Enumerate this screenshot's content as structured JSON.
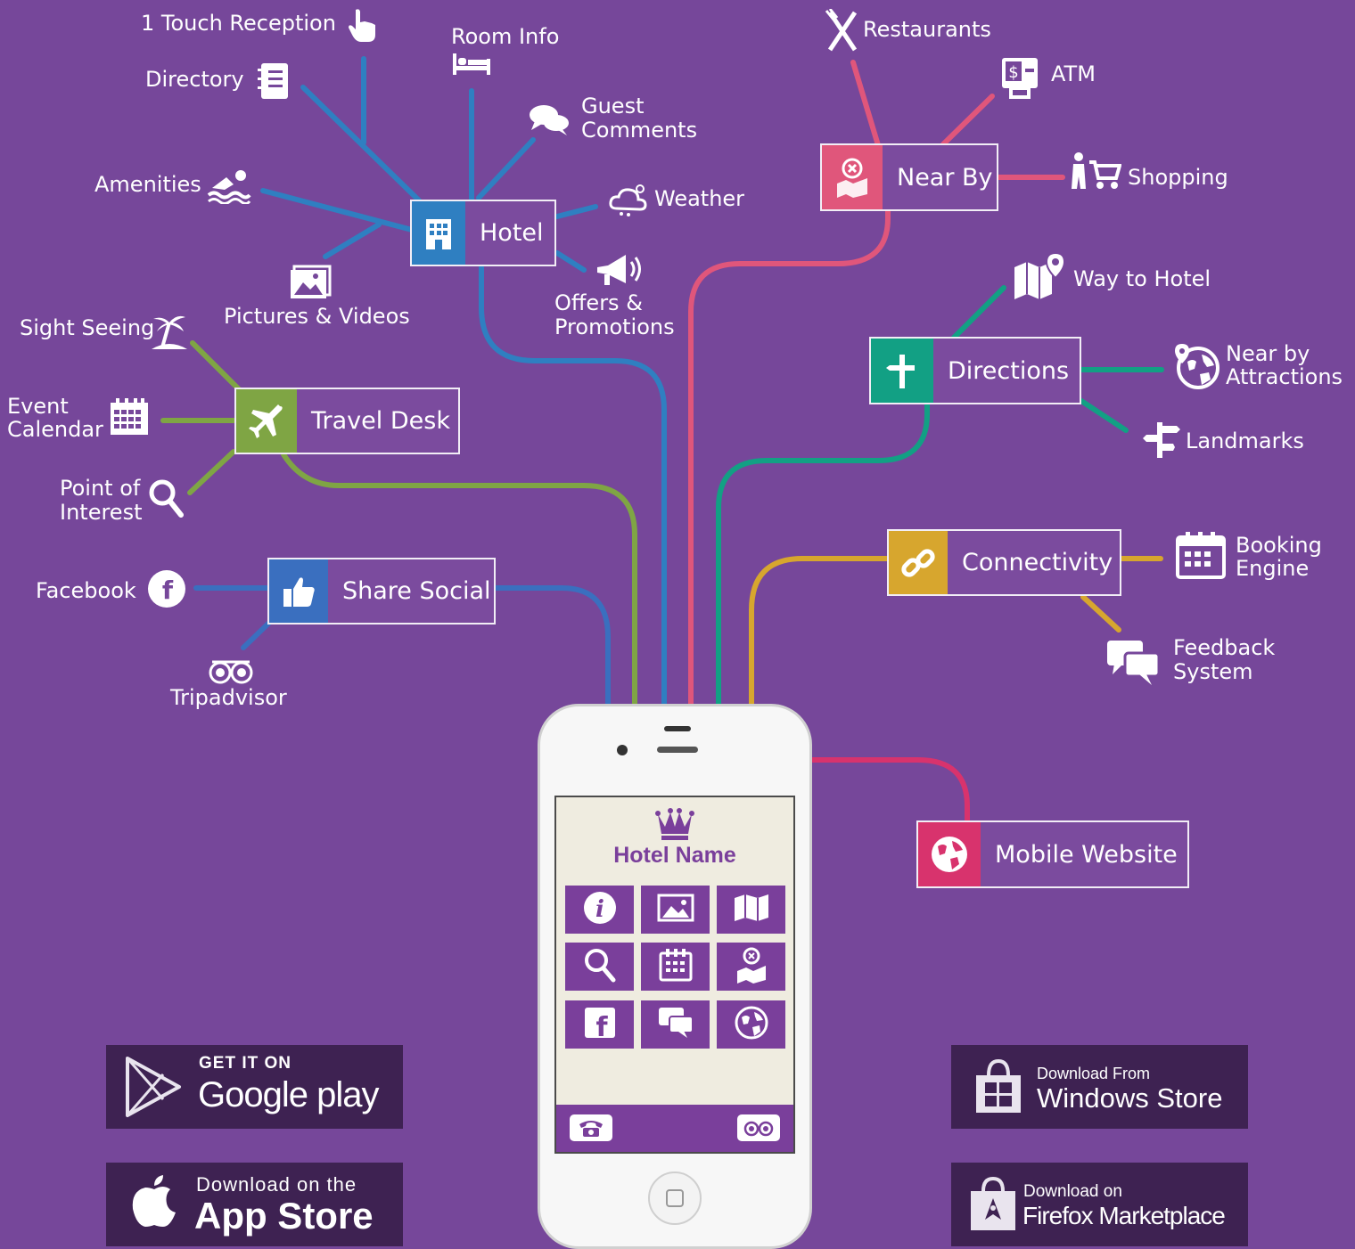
{
  "hubs": {
    "hotel": {
      "label": "Hotel",
      "color": "#2f7fc1"
    },
    "near_by": {
      "label": "Near By",
      "color": "#e0567b"
    },
    "directions": {
      "label": "Directions",
      "color": "#12a084"
    },
    "travel_desk": {
      "label": "Travel Desk",
      "color": "#7fa544"
    },
    "connectivity": {
      "label": "Connectivity",
      "color": "#d7a62e"
    },
    "share_social": {
      "label": "Share Social",
      "color": "#3a6fbf"
    },
    "mobile_website": {
      "label": "Mobile Website",
      "color": "#d8336d"
    }
  },
  "leaves": {
    "touch_reception": "1 Touch Reception",
    "room_info": "Room Info",
    "directory": "Directory",
    "guest_comments_1": "Guest",
    "guest_comments_2": "Comments",
    "amenities": "Amenities",
    "weather": "Weather",
    "pictures_videos": "Pictures & Videos",
    "offers_1": "Offers &",
    "offers_2": "Promotions",
    "restaurants": "Restaurants",
    "atm": "ATM",
    "shopping": "Shopping",
    "way_to_hotel": "Way to Hotel",
    "near_by_attractions_1": "Near by",
    "near_by_attractions_2": "Attractions",
    "landmarks": "Landmarks",
    "sight_seeing": "Sight Seeing",
    "event_calendar_1": "Event",
    "event_calendar_2": "Calendar",
    "poi_1": "Point of",
    "poi_2": "Interest",
    "facebook": "Facebook",
    "tripadvisor": "Tripadvisor",
    "booking_engine_1": "Booking",
    "booking_engine_2": "Engine",
    "feedback_1": "Feedback",
    "feedback_2": "System"
  },
  "phone": {
    "hotel_name": "Hotel Name"
  },
  "stores": {
    "google_small": "GET IT ON",
    "google_big": "Google play",
    "apple_small": "Download on the",
    "apple_big": "App Store",
    "windows_small": "Download From",
    "windows_big": "Windows Store",
    "firefox_small": "Download on",
    "firefox_big": "Firefox Marketplace"
  },
  "colors": {
    "background": "#76479a",
    "store_bg": "#3e2252",
    "tile": "#7a3f9b"
  }
}
